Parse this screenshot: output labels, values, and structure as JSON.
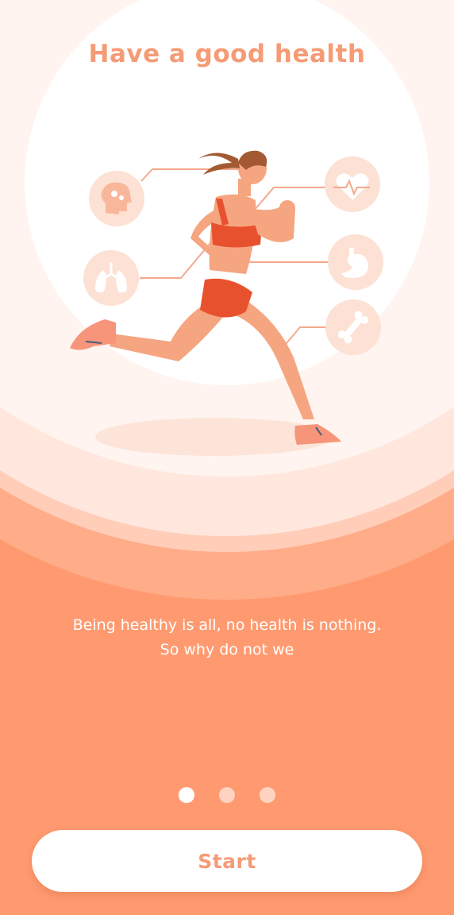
{
  "onboarding": {
    "title": "Have a good health",
    "description_line1": "Being healthy is all, no health is nothing.",
    "description_line2": "So why do not we",
    "pagination": {
      "current": 1,
      "total": 3
    },
    "start_label": "Start"
  },
  "icons": [
    "brain-gears-icon",
    "lungs-icon",
    "heartbeat-icon",
    "stomach-icon",
    "bone-icon"
  ],
  "colors": {
    "background": "#ff9a70",
    "accent": "#f59b75",
    "button": "#ffffff"
  }
}
